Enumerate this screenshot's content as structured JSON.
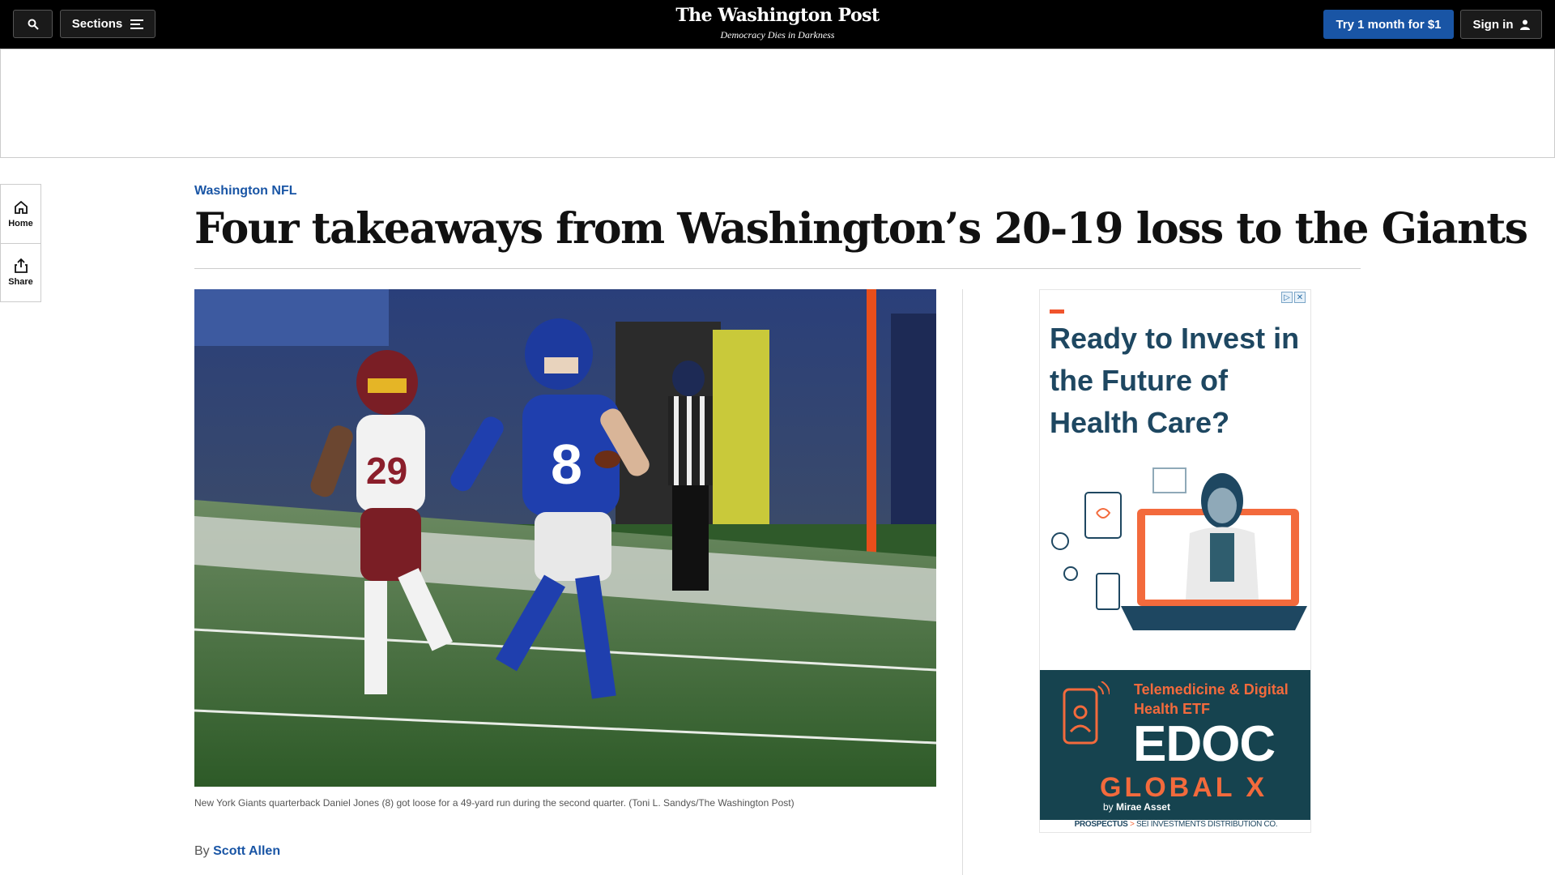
{
  "nav": {
    "sections_label": "Sections",
    "logo": "The Washington Post",
    "tagline": "Democracy Dies in Darkness",
    "try_label": "Try 1 month for $1",
    "signin_label": "Sign in"
  },
  "rail": {
    "home_label": "Home",
    "share_label": "Share"
  },
  "article": {
    "kicker": "Washington NFL",
    "headline": "Four takeaways from Washington’s 20-19 loss to the Giants",
    "caption": "New York Giants quarterback Daniel Jones (8) got loose for a 49-yard run during the second quarter. (Toni L. Sandys/The Washington Post)",
    "byline_prefix": "By",
    "author": "Scott Allen"
  },
  "ad": {
    "title": "Ready to Invest in the Future of Health Care?",
    "line1": "Telemedicine & Digital Health ETF",
    "edoc": "EDOC",
    "globalx": "GLOBAL X",
    "by": "by",
    "by_brand": "Mirae Asset",
    "prospectus": "PROSPECTUS",
    "distributor": "SEI INVESTMENTS DISTRIBUTION CO.",
    "accent": "#f36a3c",
    "navy": "#1e4761"
  },
  "colors": {
    "brand_blue": "#1955a5",
    "topbar": "#000000"
  }
}
